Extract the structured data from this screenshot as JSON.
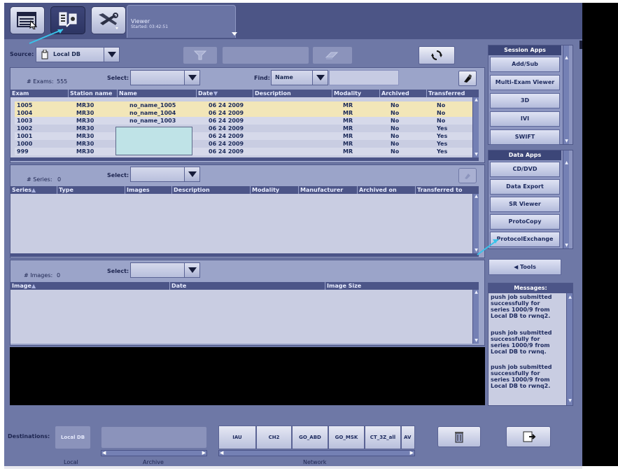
{
  "viewer_tab": {
    "title": "Viewer",
    "subtitle": "Started: 03:42:51"
  },
  "source": {
    "label": "Source:",
    "value": "Local DB"
  },
  "exams": {
    "count_label": "# Exams:",
    "count": "555",
    "select_label": "Select:",
    "find_label": "Find:",
    "find_field": "Name",
    "columns": [
      "Exam",
      "Station name",
      "Name",
      "Date",
      "Description",
      "Modality",
      "Archived",
      "Transferred"
    ],
    "rows": [
      [
        "1005",
        "MR30",
        "no_name_1005",
        "06 24 2009",
        "",
        "MR",
        "No",
        "No"
      ],
      [
        "1004",
        "MR30",
        "no_name_1004",
        "06 24 2009",
        "",
        "MR",
        "No",
        "No"
      ],
      [
        "1003",
        "MR30",
        "no_name_1003",
        "06 24 2009",
        "",
        "MR",
        "No",
        "No"
      ],
      [
        "1002",
        "MR30",
        "",
        "06 24 2009",
        "",
        "MR",
        "No",
        "Yes"
      ],
      [
        "1001",
        "MR30",
        "",
        "06 24 2009",
        "",
        "MR",
        "No",
        "Yes"
      ],
      [
        "1000",
        "MR30",
        "",
        "06 24 2009",
        "",
        "MR",
        "No",
        "Yes"
      ],
      [
        "999",
        "MR30",
        "",
        "06 24 2009",
        "",
        "MR",
        "No",
        "Yes"
      ]
    ]
  },
  "series": {
    "count_label": "# Series:",
    "count": "0",
    "select_label": "Select:",
    "columns": [
      "Series",
      "Type",
      "Images",
      "Description",
      "Modality",
      "Manufacturer",
      "Archived on",
      "Transferred to"
    ]
  },
  "images": {
    "count_label": "# Images:",
    "count": "0",
    "select_label": "Select:",
    "columns": [
      "Image",
      "Date",
      "Image Size"
    ]
  },
  "session_apps": {
    "title": "Session Apps",
    "items": [
      "Add/Sub",
      "Multi-Exam Viewer",
      "3D",
      "IVI",
      "SWIFT"
    ]
  },
  "data_apps": {
    "title": "Data Apps",
    "items": [
      "CD/DVD",
      "Data Export",
      "SR Viewer",
      "ProtoCopy",
      "ProtocolExchange"
    ]
  },
  "tools": {
    "label": "Tools"
  },
  "messages": {
    "title": "Messages:",
    "items": [
      "push job submitted successfully for series 1000/9 from Local DB to rwnq2.",
      "push job submitted successfully for series 1000/9 from Local DB to rwnq.",
      "push job submitted successfully for series 1000/9 from Local DB to rwnq2."
    ]
  },
  "destinations": {
    "label": "Destinations:",
    "local_button": "Local DB",
    "network": [
      "IAU",
      "CH2",
      "GO_ABD",
      "GO_MSK",
      "CT_3Z_all",
      "AV"
    ],
    "captions": {
      "local": "Local",
      "archive": "Archive",
      "network": "Network"
    }
  },
  "colors": {
    "background": "#6e78a6",
    "header": "#4c5588",
    "selected_row": "#f2e6b8",
    "annotation_arrow": "#39c3ea"
  }
}
